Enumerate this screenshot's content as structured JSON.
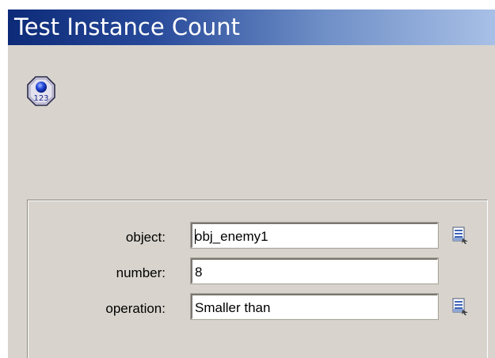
{
  "window": {
    "title": "Test Instance Count"
  },
  "action": {
    "icon": "instance-count-icon",
    "icon_label": "123"
  },
  "form": {
    "object": {
      "label": "object:",
      "value": "obj_enemy1",
      "browse_icon": "browse-menu-icon"
    },
    "number": {
      "label": "number:",
      "value": "8"
    },
    "operation": {
      "label": "operation:",
      "value": "Smaller than",
      "browse_icon": "browse-menu-icon"
    }
  },
  "colors": {
    "title_gradient_start": "#0c2a78",
    "title_gradient_end": "#a8c0e6",
    "dialog_background": "#d8d4cd",
    "icon_blue": "#1b3fd1"
  }
}
